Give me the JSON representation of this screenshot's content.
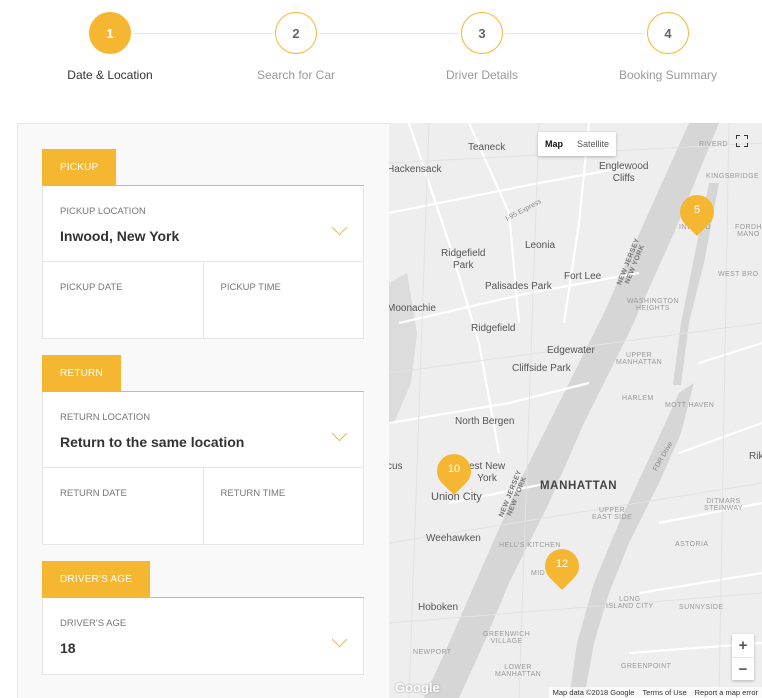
{
  "stepper": {
    "steps": [
      {
        "number": "1",
        "label": "Date & Location",
        "active": true
      },
      {
        "number": "2",
        "label": "Search for Car",
        "active": false
      },
      {
        "number": "3",
        "label": "Driver Details",
        "active": false
      },
      {
        "number": "4",
        "label": "Booking Summary",
        "active": false
      }
    ]
  },
  "form": {
    "pickup": {
      "section_title": "PICKUP",
      "location_label": "PICKUP LOCATION",
      "location_value": "Inwood, New York",
      "date_label": "PICKUP DATE",
      "time_label": "PICKUP TIME"
    },
    "return": {
      "section_title": "RETURN",
      "location_label": "RETURN LOCATION",
      "location_value": "Return to the same location",
      "date_label": "RETURN DATE",
      "time_label": "RETURN TIME"
    },
    "driver": {
      "section_title": "DRIVER'S AGE",
      "age_label": "DRIVER'S AGE",
      "age_value": "18"
    }
  },
  "map": {
    "type_map": "Map",
    "type_satellite": "Satellite",
    "zoom_in": "+",
    "zoom_out": "−",
    "markers": [
      "5",
      "10",
      "12"
    ],
    "places": {
      "teaneck": "Teaneck",
      "hackensack": "Hackensack",
      "englewood_cliffs": "Englewood\nCliffs",
      "riverdale": "RIVERD",
      "kingsbridge": "KINGSBRIDGE",
      "i95": "I-95 Express",
      "leonia": "Leonia",
      "ridgefield_park": "Ridgefield\nPark",
      "fort_lee": "Fort Lee",
      "new_jersey_ny_1": "NEW JERSEY\nNEW YORK",
      "inwood": "INWOOD",
      "fordham": "FORDH\nMANO",
      "west_bronx": "WEST BRO",
      "washington_heights": "WASHINGTON\nHEIGHTS",
      "palisades_park": "Palisades Park",
      "moonachie": "Moonachie",
      "ridgefield": "Ridgefield",
      "edgewater": "Edgewater",
      "cliffside_park": "Cliffside Park",
      "upper_manhattan": "UPPER\nMANHATTAN",
      "harlem": "HARLEM",
      "mott_haven": "MOTT HAVEN",
      "north_bergen": "North Bergen",
      "fdr_drive": "FDR Drive",
      "secaucus": "cus",
      "west_new_york": "est New\nYork",
      "union_city": "Union City",
      "new_jersey_ny_2": "NEW JERSEY\nNEW YORK",
      "manhattan": "MANHATTAN",
      "upper_east_side": "UPPER\nEAST SIDE",
      "ditmars": "DITMARS\nSTEINWAY",
      "weehawken": "Weehawken",
      "hells_kitchen": "HELL'S KITCHEN",
      "midtown": "MID",
      "astoria": "ASTORIA",
      "hoboken": "Hoboken",
      "long_island_city": "LONG\nISLAND CITY",
      "sunnyside": "SUNNYSIDE",
      "greenwich_village": "GREENWICH\nVILLAGE",
      "newport": "NEWPORT",
      "lower_manhattan": "LOWER\nMANHATTAN",
      "greenpoint": "GREENPOINT",
      "rik": "Rik"
    },
    "attribution": {
      "data": "Map data ©2018 Google",
      "terms": "Terms of Use",
      "report": "Report a map error"
    },
    "logo": "Google"
  },
  "colors": {
    "accent": "#f5b731",
    "water": "#d6d6d6",
    "land": "#eeeeee"
  }
}
